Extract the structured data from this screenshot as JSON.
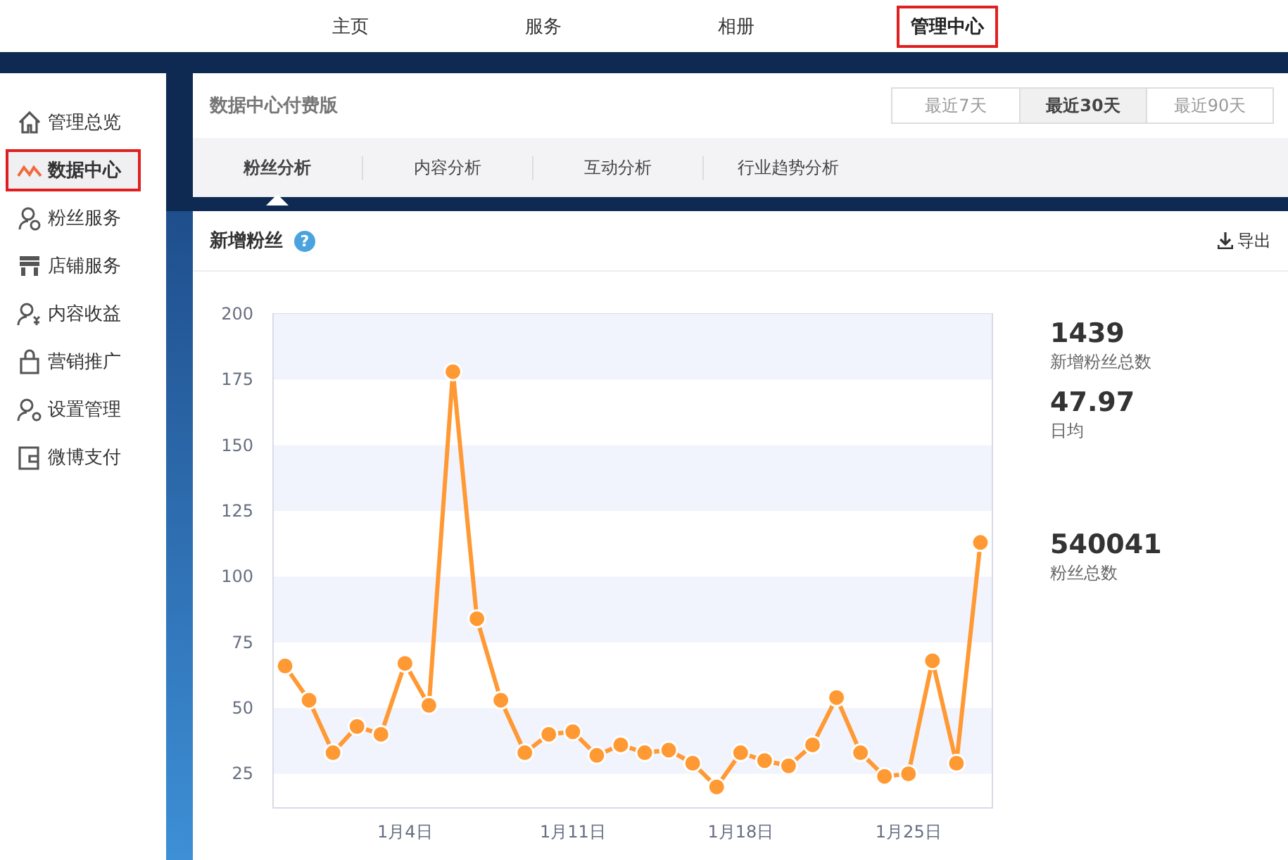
{
  "top_nav": [
    {
      "label": "主页",
      "selected": false
    },
    {
      "label": "服务",
      "selected": false
    },
    {
      "label": "相册",
      "selected": false
    },
    {
      "label": "管理中心",
      "selected": true
    }
  ],
  "sidebar": {
    "items": [
      {
        "label": "管理总览",
        "kind": "home",
        "selected": false
      },
      {
        "label": "数据中心",
        "kind": "trend",
        "selected": true
      },
      {
        "label": "粉丝服务",
        "kind": "fans",
        "selected": false
      },
      {
        "label": "店铺服务",
        "kind": "store",
        "selected": false
      },
      {
        "label": "内容收益",
        "kind": "income",
        "selected": false
      },
      {
        "label": "营销推广",
        "kind": "bag",
        "selected": false
      },
      {
        "label": "设置管理",
        "kind": "settings",
        "selected": false
      },
      {
        "label": "微博支付",
        "kind": "wallet",
        "selected": false
      }
    ]
  },
  "header": {
    "title": "数据中心付费版",
    "ranges": [
      {
        "label": "最近7天",
        "selected": false
      },
      {
        "label": "最近30天",
        "selected": true
      },
      {
        "label": "最近90天",
        "selected": false
      }
    ]
  },
  "tabs": [
    {
      "label": "粉丝分析",
      "selected": true
    },
    {
      "label": "内容分析",
      "selected": false
    },
    {
      "label": "互动分析",
      "selected": false
    },
    {
      "label": "行业趋势分析",
      "selected": false
    }
  ],
  "section": {
    "title": "新增粉丝",
    "help": "?",
    "export_label": "导出",
    "chart_data": {
      "type": "line",
      "categories": [
        null,
        null,
        null,
        null,
        null,
        "1月4日",
        null,
        null,
        null,
        null,
        null,
        null,
        "1月11日",
        null,
        null,
        null,
        null,
        null,
        null,
        "1月18日",
        null,
        null,
        null,
        null,
        null,
        null,
        "1月25日",
        null,
        null,
        null
      ],
      "series": [
        {
          "color": "#ff9933",
          "marker": "circle",
          "values": [
            66,
            53,
            33,
            43,
            40,
            67,
            51,
            178,
            84,
            53,
            33,
            40,
            41,
            32,
            36,
            33,
            34,
            29,
            20,
            33,
            30,
            28,
            36,
            54,
            33,
            24,
            25,
            68,
            29,
            113
          ]
        }
      ],
      "ylim": [
        12,
        200
      ],
      "yticks": [
        25,
        50,
        75,
        100,
        125,
        150,
        175,
        200
      ]
    },
    "stats": [
      {
        "value": "1439",
        "label": "新增粉丝总数"
      },
      {
        "value": "47.97",
        "label": "日均"
      },
      {
        "value": "540041",
        "label": "粉丝总数"
      }
    ]
  }
}
